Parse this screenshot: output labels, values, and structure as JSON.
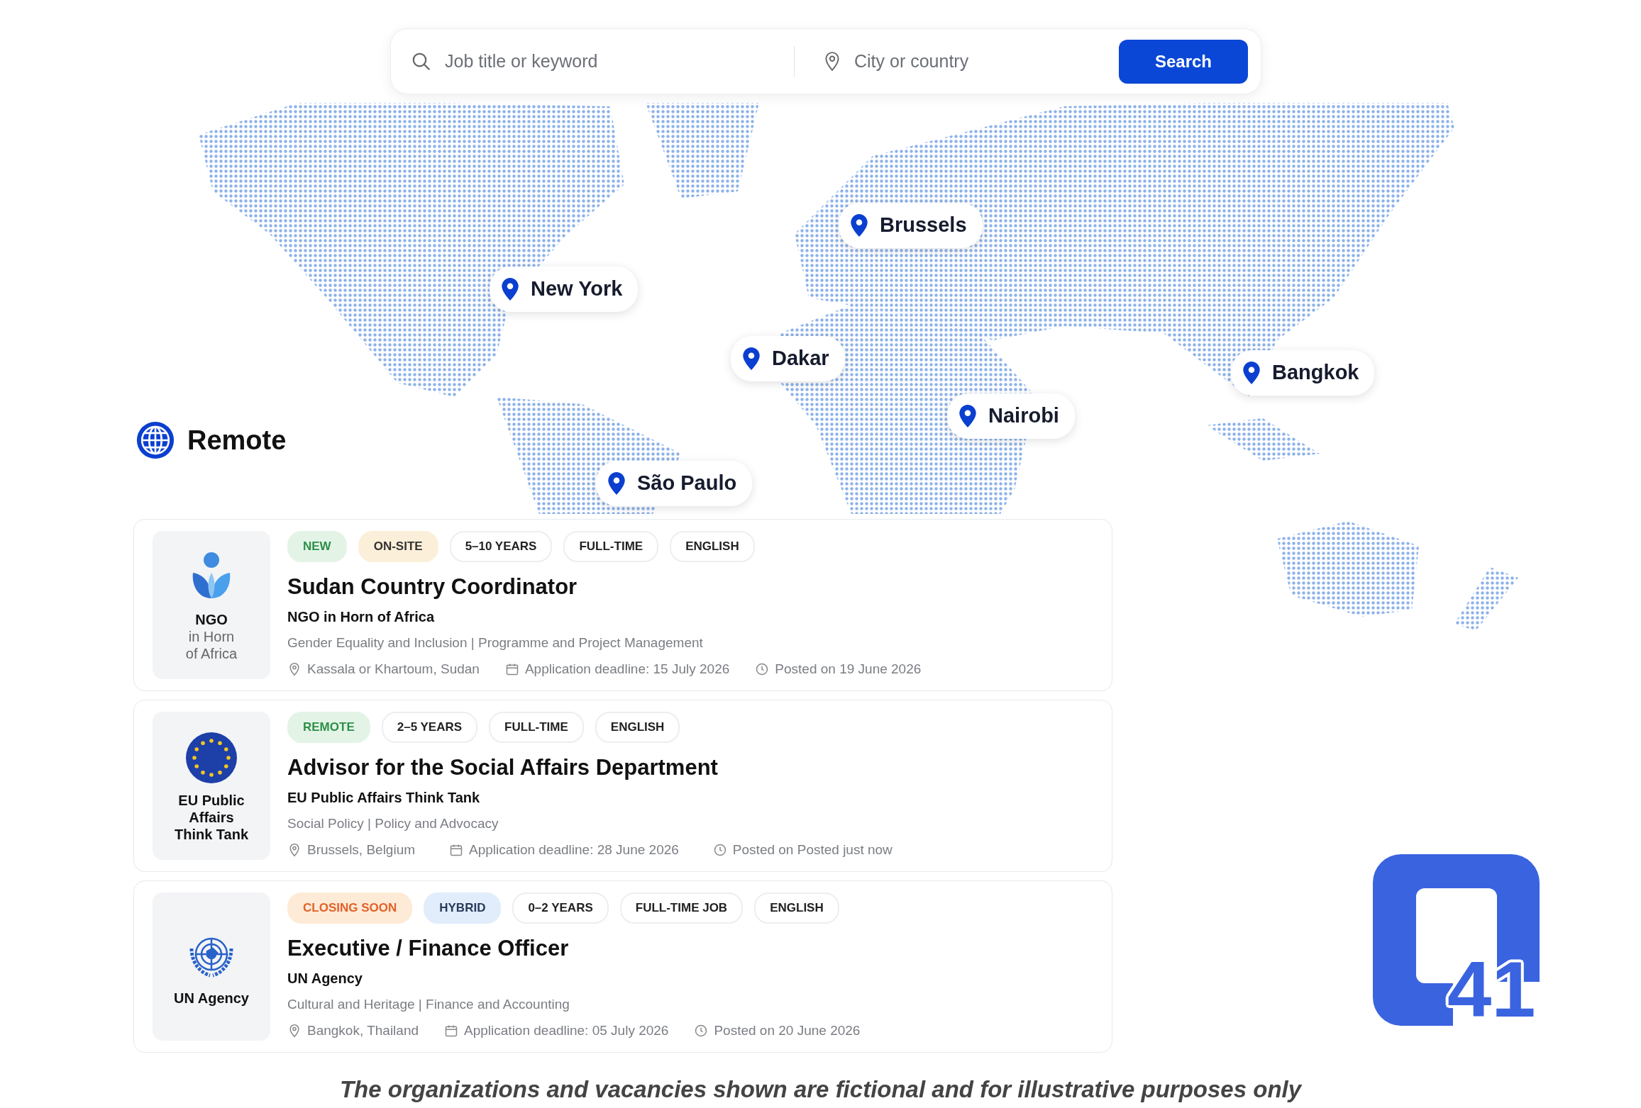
{
  "search": {
    "keyword_placeholder": "Job title or keyword",
    "location_placeholder": "City or country",
    "button": "Search"
  },
  "map": {
    "remote_label": "Remote",
    "cities": [
      {
        "name": "Brussels"
      },
      {
        "name": "New York"
      },
      {
        "name": "Dakar"
      },
      {
        "name": "Bangkok"
      },
      {
        "name": "Nairobi"
      },
      {
        "name": "São Paulo"
      }
    ]
  },
  "jobs": [
    {
      "logo_lines": [
        {
          "text": "NGO",
          "emphasis": true
        },
        {
          "text": "in Horn",
          "emphasis": false
        },
        {
          "text": "of Africa",
          "emphasis": false
        }
      ],
      "tags": [
        {
          "label": "NEW",
          "kind": "new"
        },
        {
          "label": "ON-SITE",
          "kind": "onsite"
        },
        {
          "label": "5–10 YEARS",
          "kind": "plain"
        },
        {
          "label": "FULL-TIME",
          "kind": "plain"
        },
        {
          "label": "ENGLISH",
          "kind": "plain"
        }
      ],
      "title": "Sudan Country Coordinator",
      "organization": "NGO in Horn of Africa",
      "categories": "Gender Equality and Inclusion | Programme and Project Management",
      "location": "Kassala or Khartoum, Sudan",
      "deadline": "Application deadline: 15 July 2026",
      "posted": "Posted on 19 June 2026"
    },
    {
      "logo_lines": [
        {
          "text": "EU Public",
          "emphasis": true
        },
        {
          "text": "Affairs",
          "emphasis": true
        },
        {
          "text": "Think Tank",
          "emphasis": true
        }
      ],
      "tags": [
        {
          "label": "REMOTE",
          "kind": "new"
        },
        {
          "label": "2–5 YEARS",
          "kind": "plain"
        },
        {
          "label": "FULL-TIME",
          "kind": "plain"
        },
        {
          "label": "ENGLISH",
          "kind": "plain"
        }
      ],
      "title": "Advisor for the Social Affairs Department",
      "organization": "EU Public Affairs Think Tank",
      "categories": "Social Policy | Policy and Advocacy",
      "location": "Brussels, Belgium",
      "deadline": "Application deadline: 28 June 2026",
      "posted": "Posted on Posted just now"
    },
    {
      "logo_lines": [
        {
          "text": "UN Agency",
          "emphasis": true
        }
      ],
      "tags": [
        {
          "label": "CLOSING SOON",
          "kind": "closing"
        },
        {
          "label": "HYBRID",
          "kind": "hybrid"
        },
        {
          "label": "0–2 YEARS",
          "kind": "plain"
        },
        {
          "label": "FULL-TIME JOB",
          "kind": "plain"
        },
        {
          "label": "ENGLISH",
          "kind": "plain"
        }
      ],
      "title": "Executive / Finance Officer",
      "organization": "UN Agency",
      "categories": "Cultural and Heritage | Finance and Accounting",
      "location": "Bangkok, Thailand",
      "deadline": "Application deadline: 05 July 2026",
      "posted": "Posted on 20 June 2026"
    }
  ],
  "brand": {
    "number": "41"
  },
  "caption": "The organizations and vacancies shown are fictional and for illustrative purposes only"
}
